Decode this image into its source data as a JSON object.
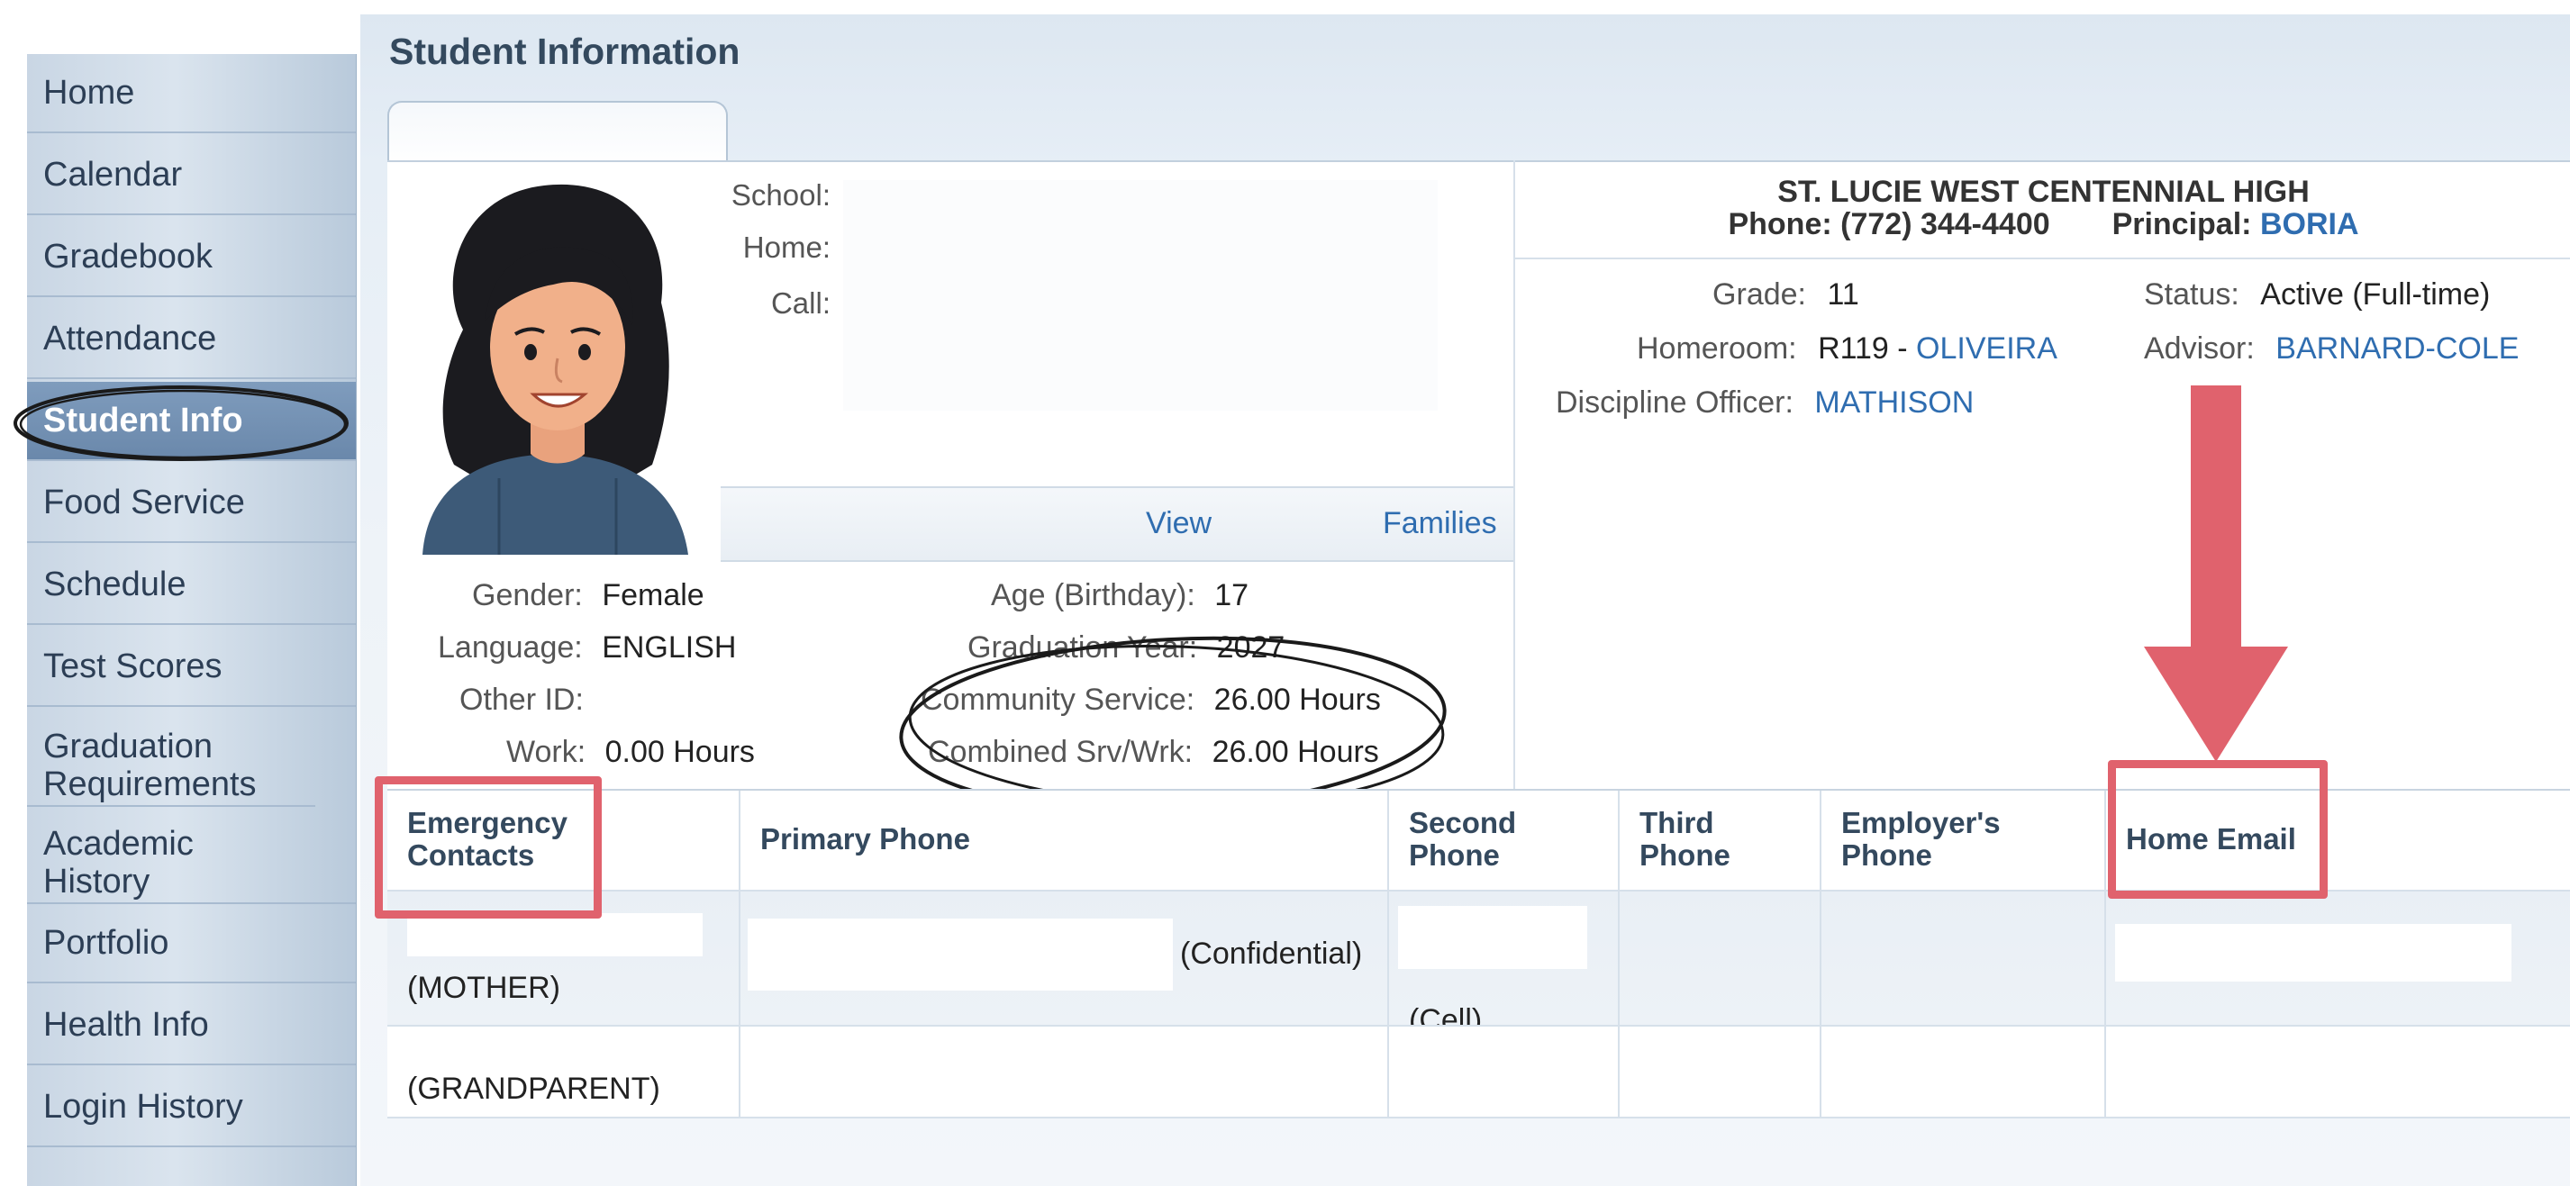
{
  "sidebar": {
    "items": [
      {
        "label": "Home"
      },
      {
        "label": "Calendar"
      },
      {
        "label": "Gradebook"
      },
      {
        "label": "Attendance"
      },
      {
        "label": "Student Info"
      },
      {
        "label": "Food Service"
      },
      {
        "label": "Schedule"
      },
      {
        "label": "Test Scores"
      },
      {
        "label": "Graduation Requirements"
      },
      {
        "label": "Academic History"
      },
      {
        "label": "Portfolio"
      },
      {
        "label": "Health Info"
      },
      {
        "label": "Login History"
      }
    ],
    "active": "Student Info"
  },
  "page": {
    "title": "Student Information"
  },
  "contact": {
    "school_label": "School:",
    "home_label": "Home:",
    "cell_label": "Call:"
  },
  "school": {
    "name": "ST. LUCIE WEST CENTENNIAL HIGH",
    "phone_label": "Phone:",
    "phone": "(772) 344-4400",
    "principal_label": "Principal:",
    "principal": "BORIA"
  },
  "student": {
    "grade_label": "Grade:",
    "grade": "11",
    "status_label": "Status:",
    "status": "Active (Full-time)",
    "homeroom_label": "Homeroom:",
    "homeroom_room": "R119 - ",
    "homeroom_teacher": "OLIVEIRA",
    "advisor_label": "Advisor:",
    "advisor": "BARNARD-COLE",
    "discipline_label": "Discipline Officer:",
    "discipline": "MATHISON"
  },
  "links": {
    "view": "View",
    "families": "Families"
  },
  "demographics": {
    "gender_label": "Gender:",
    "gender": "Female",
    "language_label": "Language:",
    "language": "ENGLISH",
    "other_id_label": "Other ID:",
    "work_label": "Work:",
    "work": "0.00 Hours",
    "age_label": "Age (Birthday):",
    "age": "17",
    "grad_year_label": "Graduation Year:",
    "grad_year": "2027",
    "community_label": "Community Service:",
    "community": "26.00 Hours",
    "combined_label": "Combined Srv/Wrk:",
    "combined": "26.00 Hours"
  },
  "contacts_table": {
    "headers": [
      "Emergency Contacts",
      "Primary Phone",
      "Second Phone",
      "Third Phone",
      "Employer's Phone",
      "Home Email"
    ],
    "rows": [
      {
        "relation": "(MOTHER)",
        "primary_note": "(Confidential)",
        "second_note": "(Cell)"
      },
      {
        "relation": "(GRANDPARENT)",
        "primary_note": "",
        "second_note": ""
      }
    ]
  },
  "colors": {
    "accent_red": "#e0626d",
    "link_blue": "#2f6db0",
    "sidebar_active": "#6a88ab"
  }
}
